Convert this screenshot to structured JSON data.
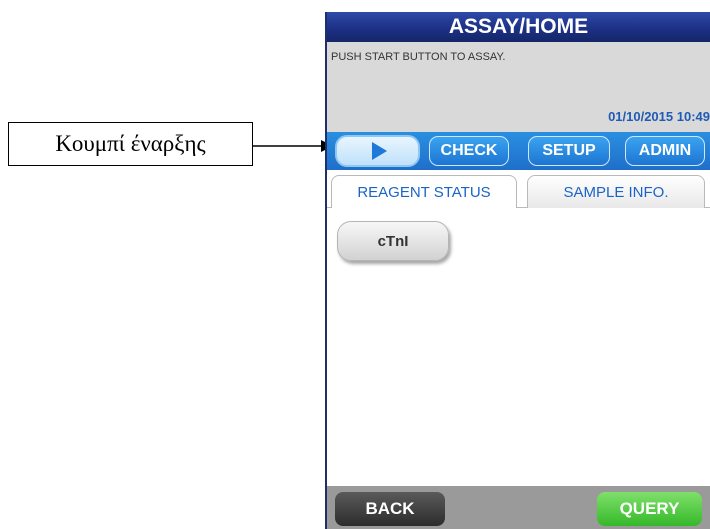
{
  "annotation": {
    "label": "Κουμπί έναρξης"
  },
  "screen": {
    "title": "ASSAY/HOME",
    "message": "PUSH START BUTTON TO ASSAY.",
    "datetime": "01/10/2015 10:49",
    "nav": {
      "start_icon": "play-icon",
      "check_label": "CHECK",
      "setup_label": "SETUP",
      "admin_label": "ADMIN"
    },
    "tabs": [
      {
        "label": "REAGENT STATUS",
        "active": true
      },
      {
        "label": "SAMPLE INFO.",
        "active": false
      }
    ],
    "reagents": [
      {
        "label": "cTnI"
      }
    ],
    "footer": {
      "back_label": "BACK",
      "query_label": "QUERY"
    },
    "colors": {
      "title_bar": "#1c2f82",
      "nav_bar": "#2a8fe0",
      "query_button": "#35b82a",
      "back_button": "#2c2c2c",
      "datetime": "#1f5bb5"
    }
  }
}
